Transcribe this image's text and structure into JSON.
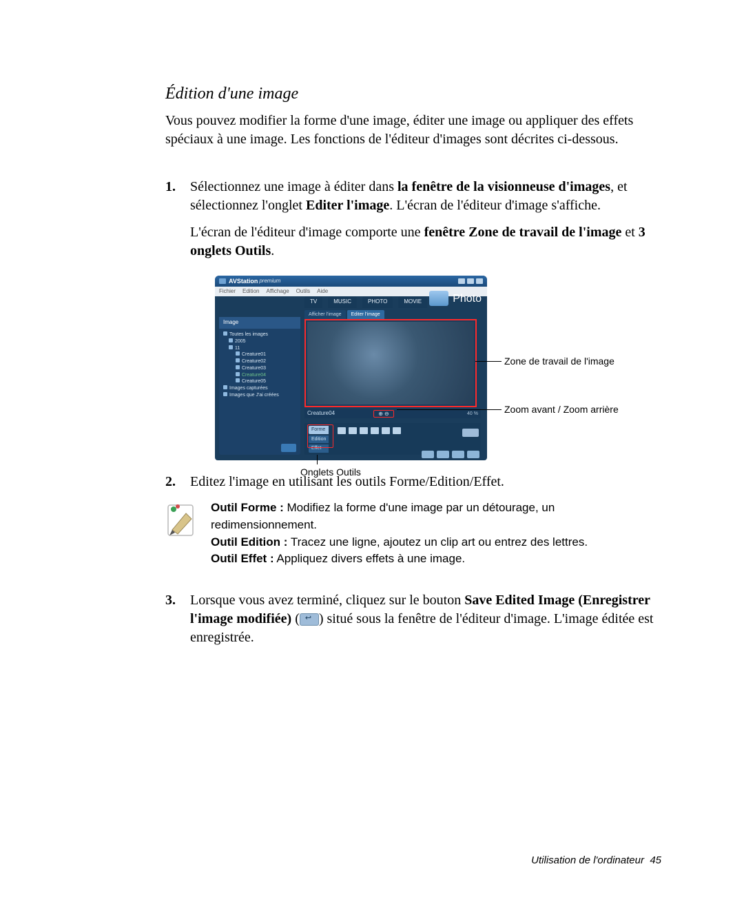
{
  "heading": "Édition d'une image",
  "intro": "Vous pouvez modifier la forme d'une image, éditer une image ou appliquer des effets spéciaux à une image. Les fonctions de l'éditeur d'images sont décrites ci-dessous.",
  "step1": {
    "num": "1.",
    "part1a": "Sélectionnez une image à éditer dans ",
    "bold1": "la fenêtre de la visionneuse d'images",
    "part1b": ", et sélectionnez l'onglet ",
    "bold2": "Editer l'image",
    "part1c": ". L'écran de l'éditeur d'image s'affiche.",
    "part2a": "L'écran de l'éditeur d'image comporte une ",
    "bold3": "fenêtre Zone de travail de l'image",
    "part2b": "  et ",
    "bold4": "3 onglets Outils",
    "part2c": "."
  },
  "screenshot": {
    "app_title": "AVStation",
    "app_subtitle": "premium",
    "menu": [
      "Fichier",
      "Edition",
      "Affichage",
      "Outils",
      "Aide"
    ],
    "category_tabs": [
      "TV",
      "MUSIC",
      "PHOTO",
      "MOVIE"
    ],
    "category_big": "Photo",
    "subtabs": {
      "view": "Afficher l'image",
      "edit": "Editer l'image"
    },
    "side_header": "Image",
    "tree": {
      "root": "Toutes les images",
      "year": "2005",
      "month": "11",
      "items": [
        "Creature01",
        "Creature02",
        "Creature03",
        "Creature04",
        "Creature05"
      ],
      "captured": "Images capturées",
      "created": "Images que J'ai créées"
    },
    "current_file": "Creature04",
    "zoomfit": "40 %",
    "tool_tabs": [
      "Forme",
      "Edition",
      "Effet"
    ]
  },
  "callouts": {
    "work_area": "Zone de travail de l'image",
    "zoom": "Zoom avant / Zoom arrière",
    "tool_tabs": "Onglets Outils"
  },
  "step2": {
    "num": "2.",
    "text": "Editez l'image en utilisant les outils Forme/Edition/Effet."
  },
  "note": {
    "forme_label": "Outil Forme :",
    "forme_text": " Modifiez la forme d'une image par un détourage, un redimensionnement.",
    "edition_label": "Outil Edition :",
    "edition_text": " Tracez une ligne, ajoutez un clip art ou entrez des lettres.",
    "effet_label": "Outil Effet :",
    "effet_text": " Appliquez divers effets à une image."
  },
  "step3": {
    "num": "3.",
    "part_a": "Lorsque vous avez terminé, cliquez sur le bouton ",
    "bold": "Save Edited Image (Enregistrer l'image modifiée)",
    "part_b": " (",
    "part_c": ") situé sous la fenêtre de l'éditeur d'image. L'image éditée est enregistrée."
  },
  "footer": {
    "label": "Utilisation de l'ordinateur",
    "page": "45"
  }
}
